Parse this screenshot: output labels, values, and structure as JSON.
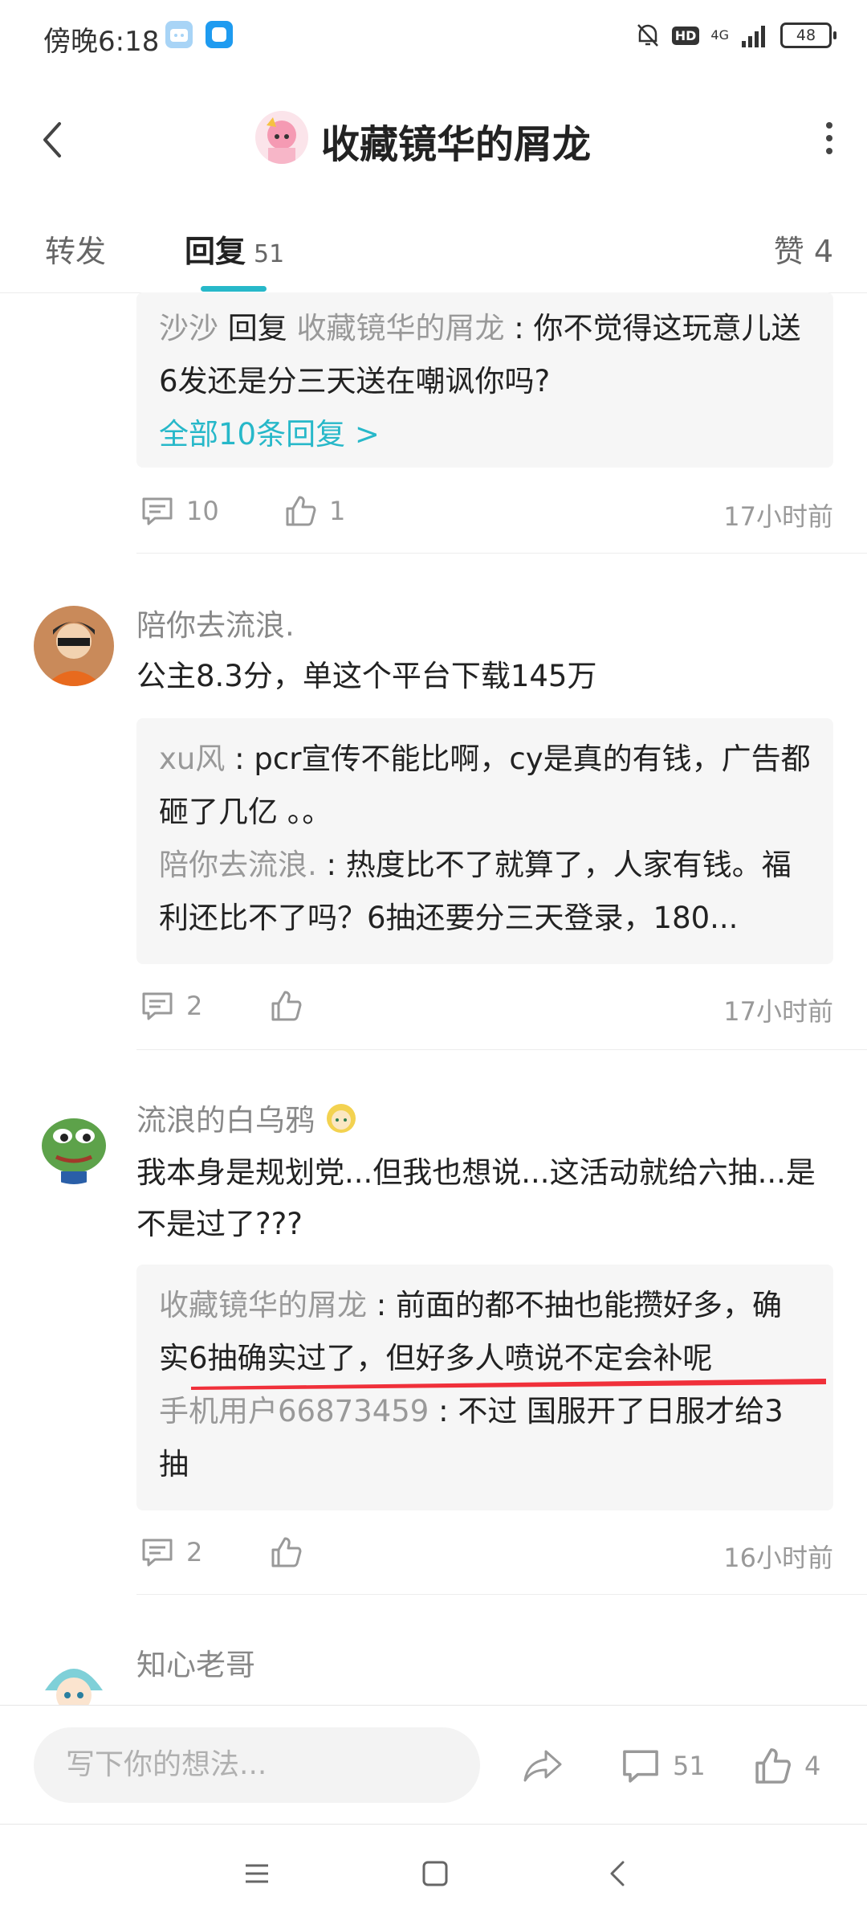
{
  "status_bar": {
    "time": "傍晚6:18",
    "hd": "HD",
    "network": "4G",
    "battery": "48"
  },
  "header": {
    "title": "收藏镜华的屑龙"
  },
  "tabs": {
    "forward": "转发",
    "reply": "回复",
    "reply_count": "51",
    "like": "赞 4"
  },
  "comments": [
    {
      "replies": [
        {
          "name": "沙沙",
          "verb": " 回复 ",
          "target": "收藏镜华的屑龙",
          "sep": " : ",
          "text": "你不觉得这玩意儿送6发还是分三天送在嘲讽你吗?"
        }
      ],
      "more_link": "全部10条回复 >",
      "reply_count": "10",
      "like_count": "1",
      "time": "17小时前"
    },
    {
      "user": "陪你去流浪.",
      "text": "公主8.3分，单这个平台下载145万",
      "replies": [
        {
          "name": "xu风",
          "sep": " : ",
          "text": "pcr宣传不能比啊，cy是真的有钱，广告都砸了几亿 。。"
        },
        {
          "name": "陪你去流浪.",
          "sep": " : ",
          "text": "热度比不了就算了，人家有钱。福利还比不了吗？6抽还要分三天登录，180..."
        }
      ],
      "reply_count": "2",
      "time": "17小时前"
    },
    {
      "user": "流浪的白乌鸦",
      "text": "我本身是规划党...但我也想说...这活动就给六抽...是不是过了???",
      "replies": [
        {
          "name": "收藏镜华的屑龙",
          "sep": " : ",
          "text": "前面的都不抽也能攒好多，确实6抽确实过了，但好多人喷说不定会补呢"
        },
        {
          "name": "手机用户66873459",
          "sep": " : ",
          "text": "不过 国服开了日服才给3抽"
        }
      ],
      "reply_count": "2",
      "time": "16小时前"
    },
    {
      "user": "知心老哥"
    }
  ],
  "bottom_bar": {
    "input_placeholder": "写下你的想法...",
    "comment_count": "51",
    "like_count": "4"
  },
  "icons": [
    "back-icon",
    "more-icon",
    "comment-icon",
    "like-icon",
    "share-icon",
    "menu-nav-icon",
    "home-nav-icon",
    "back-nav-icon",
    "mute-icon",
    "signal-icon"
  ],
  "colors": {
    "accent": "#27b8c9",
    "annotation_red": "#f0303a"
  }
}
